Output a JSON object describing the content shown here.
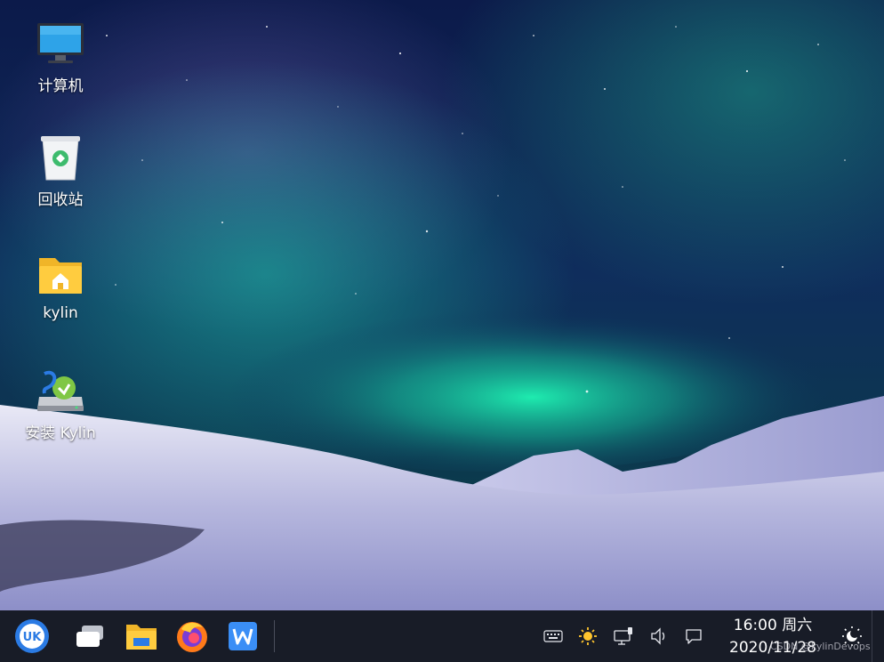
{
  "desktop": {
    "icons": [
      {
        "label": "计算机",
        "icon": "computer-icon"
      },
      {
        "label": "回收站",
        "icon": "trash-icon"
      },
      {
        "label": "kylin",
        "icon": "home-folder-icon"
      },
      {
        "label": "安装 Kylin",
        "icon": "installer-icon"
      }
    ]
  },
  "taskbar": {
    "start_icon": "ukui-start-icon",
    "apps": [
      {
        "icon": "multitask-view-icon"
      },
      {
        "icon": "file-manager-icon"
      },
      {
        "icon": "firefox-icon"
      },
      {
        "icon": "wps-writer-icon"
      }
    ],
    "tray": [
      {
        "icon": "keyboard-icon"
      },
      {
        "icon": "brightness-icon"
      },
      {
        "icon": "network-icon"
      },
      {
        "icon": "volume-icon"
      },
      {
        "icon": "notification-icon"
      }
    ],
    "clock": {
      "time": "16:00 周六",
      "date": "2020/11/28"
    },
    "night_mode_icon": "night-mode-icon"
  },
  "watermark": "CSDN @kylinDevops",
  "colors": {
    "taskbar_bg": "#191c26",
    "accent": "#2b7be4"
  }
}
